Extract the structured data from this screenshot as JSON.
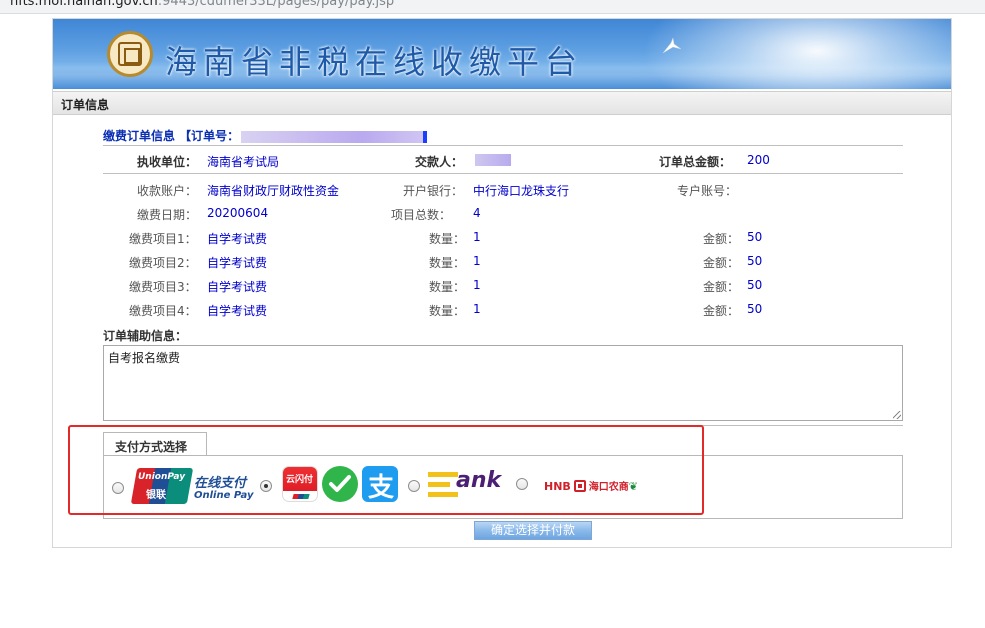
{
  "browser": {
    "url_visible": "hfts.mof.hainan.gov.cn",
    "url_dim": ":9443/cdumer33L/pages/pay/pay.jsp"
  },
  "site": {
    "title": "海南省非税在线收缴平台"
  },
  "section": {
    "title": "订单信息"
  },
  "order": {
    "header_label": "缴费订单信息 【订单号：",
    "payer_unit_label": "执收单位：",
    "payer_unit_value": "海南省考试局",
    "payer_label": "交款人：",
    "total_label": "订单总金额：",
    "total_value": "200",
    "account_label": "收款账户：",
    "account_value": "海南省财政厅财政性资金",
    "bank_label": "开户银行：",
    "bank_value": "中行海口龙珠支行",
    "special_account_label": "专户账号：",
    "date_label": "缴费日期：",
    "date_value": "20200604",
    "item_count_label": "项目总数：",
    "item_count_value": "4",
    "items": [
      {
        "label": "缴费项目1：",
        "name": "自学考试费",
        "qty_label": "数量：",
        "qty": "1",
        "amount_label": "金额：",
        "amount": "50"
      },
      {
        "label": "缴费项目2：",
        "name": "自学考试费",
        "qty_label": "数量：",
        "qty": "1",
        "amount_label": "金额：",
        "amount": "50"
      },
      {
        "label": "缴费项目3：",
        "name": "自学考试费",
        "qty_label": "数量：",
        "qty": "1",
        "amount_label": "金额：",
        "amount": "50"
      },
      {
        "label": "缴费项目4：",
        "name": "自学考试费",
        "qty_label": "数量：",
        "qty": "1",
        "amount_label": "金额：",
        "amount": "50"
      }
    ],
    "aux_label": "订单辅助信息：",
    "aux_value": "自考报名缴费"
  },
  "payment": {
    "tab_label": "支付方式选择",
    "unionpay_text": "UnionPay",
    "unionpay_cn": "银联",
    "online_pay_cn": "在线支付",
    "online_pay_en": "Online Pay",
    "yunshanfu_text": "云闪付",
    "alipay_glyph": "支",
    "ebank_text": "ank",
    "hnb_text": "HNB",
    "hnb_cn": "海口农商",
    "selected": "yunshanfu"
  },
  "confirm_label": "确定选择并付款"
}
